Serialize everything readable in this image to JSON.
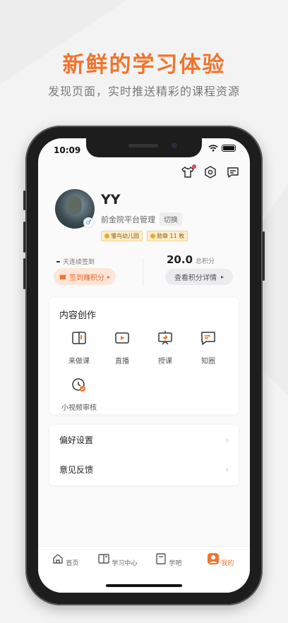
{
  "promo": {
    "headline": "新鲜的学习体验",
    "subline": "发现页面，实时推送精彩的课程资源"
  },
  "status_bar": {
    "time": "10:09"
  },
  "profile": {
    "name": "YY",
    "organization": "前金院平台管理",
    "switch_label": "切换",
    "badges": [
      "雏鸟幼儿园",
      "勋章 11 枚"
    ],
    "gender_symbol": "♂"
  },
  "checkin": {
    "label": "天连续签到",
    "button": "签到赚积分",
    "button_arrow": "▸"
  },
  "points": {
    "value": "20.0",
    "label": "总积分",
    "button": "查看积分详情",
    "button_arrow": "▸"
  },
  "content_creation": {
    "title": "内容创作",
    "tools": [
      {
        "label": "来做课",
        "icon": "book-icon"
      },
      {
        "label": "直播",
        "icon": "live-icon"
      },
      {
        "label": "授课",
        "icon": "teach-icon"
      },
      {
        "label": "知圈",
        "icon": "chat-icon"
      },
      {
        "label": "小视频审核",
        "icon": "video-review-icon"
      }
    ]
  },
  "settings": {
    "items": [
      {
        "label": "偏好设置",
        "chevron": "›"
      },
      {
        "label": "意见反馈",
        "chevron": "›"
      }
    ]
  },
  "tabbar": {
    "tabs": [
      {
        "label": "首页",
        "icon": "home-icon"
      },
      {
        "label": "学习中心",
        "icon": "study-icon"
      },
      {
        "label": "学吧",
        "icon": "forum-icon"
      },
      {
        "label": "我的",
        "icon": "profile-icon"
      }
    ],
    "active": 3
  },
  "colors": {
    "accent": "#f0752d",
    "badge_bg": "#fdeecd",
    "checkin_bg": "#fde5d8"
  }
}
